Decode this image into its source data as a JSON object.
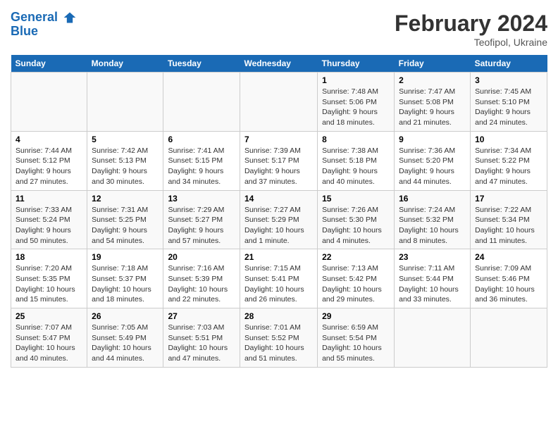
{
  "header": {
    "logo_line1": "General",
    "logo_line2": "Blue",
    "month_year": "February 2024",
    "location": "Teofipol, Ukraine"
  },
  "days_of_week": [
    "Sunday",
    "Monday",
    "Tuesday",
    "Wednesday",
    "Thursday",
    "Friday",
    "Saturday"
  ],
  "weeks": [
    [
      {
        "day": "",
        "info": ""
      },
      {
        "day": "",
        "info": ""
      },
      {
        "day": "",
        "info": ""
      },
      {
        "day": "",
        "info": ""
      },
      {
        "day": "1",
        "info": "Sunrise: 7:48 AM\nSunset: 5:06 PM\nDaylight: 9 hours\nand 18 minutes."
      },
      {
        "day": "2",
        "info": "Sunrise: 7:47 AM\nSunset: 5:08 PM\nDaylight: 9 hours\nand 21 minutes."
      },
      {
        "day": "3",
        "info": "Sunrise: 7:45 AM\nSunset: 5:10 PM\nDaylight: 9 hours\nand 24 minutes."
      }
    ],
    [
      {
        "day": "4",
        "info": "Sunrise: 7:44 AM\nSunset: 5:12 PM\nDaylight: 9 hours\nand 27 minutes."
      },
      {
        "day": "5",
        "info": "Sunrise: 7:42 AM\nSunset: 5:13 PM\nDaylight: 9 hours\nand 30 minutes."
      },
      {
        "day": "6",
        "info": "Sunrise: 7:41 AM\nSunset: 5:15 PM\nDaylight: 9 hours\nand 34 minutes."
      },
      {
        "day": "7",
        "info": "Sunrise: 7:39 AM\nSunset: 5:17 PM\nDaylight: 9 hours\nand 37 minutes."
      },
      {
        "day": "8",
        "info": "Sunrise: 7:38 AM\nSunset: 5:18 PM\nDaylight: 9 hours\nand 40 minutes."
      },
      {
        "day": "9",
        "info": "Sunrise: 7:36 AM\nSunset: 5:20 PM\nDaylight: 9 hours\nand 44 minutes."
      },
      {
        "day": "10",
        "info": "Sunrise: 7:34 AM\nSunset: 5:22 PM\nDaylight: 9 hours\nand 47 minutes."
      }
    ],
    [
      {
        "day": "11",
        "info": "Sunrise: 7:33 AM\nSunset: 5:24 PM\nDaylight: 9 hours\nand 50 minutes."
      },
      {
        "day": "12",
        "info": "Sunrise: 7:31 AM\nSunset: 5:25 PM\nDaylight: 9 hours\nand 54 minutes."
      },
      {
        "day": "13",
        "info": "Sunrise: 7:29 AM\nSunset: 5:27 PM\nDaylight: 9 hours\nand 57 minutes."
      },
      {
        "day": "14",
        "info": "Sunrise: 7:27 AM\nSunset: 5:29 PM\nDaylight: 10 hours\nand 1 minute."
      },
      {
        "day": "15",
        "info": "Sunrise: 7:26 AM\nSunset: 5:30 PM\nDaylight: 10 hours\nand 4 minutes."
      },
      {
        "day": "16",
        "info": "Sunrise: 7:24 AM\nSunset: 5:32 PM\nDaylight: 10 hours\nand 8 minutes."
      },
      {
        "day": "17",
        "info": "Sunrise: 7:22 AM\nSunset: 5:34 PM\nDaylight: 10 hours\nand 11 minutes."
      }
    ],
    [
      {
        "day": "18",
        "info": "Sunrise: 7:20 AM\nSunset: 5:35 PM\nDaylight: 10 hours\nand 15 minutes."
      },
      {
        "day": "19",
        "info": "Sunrise: 7:18 AM\nSunset: 5:37 PM\nDaylight: 10 hours\nand 18 minutes."
      },
      {
        "day": "20",
        "info": "Sunrise: 7:16 AM\nSunset: 5:39 PM\nDaylight: 10 hours\nand 22 minutes."
      },
      {
        "day": "21",
        "info": "Sunrise: 7:15 AM\nSunset: 5:41 PM\nDaylight: 10 hours\nand 26 minutes."
      },
      {
        "day": "22",
        "info": "Sunrise: 7:13 AM\nSunset: 5:42 PM\nDaylight: 10 hours\nand 29 minutes."
      },
      {
        "day": "23",
        "info": "Sunrise: 7:11 AM\nSunset: 5:44 PM\nDaylight: 10 hours\nand 33 minutes."
      },
      {
        "day": "24",
        "info": "Sunrise: 7:09 AM\nSunset: 5:46 PM\nDaylight: 10 hours\nand 36 minutes."
      }
    ],
    [
      {
        "day": "25",
        "info": "Sunrise: 7:07 AM\nSunset: 5:47 PM\nDaylight: 10 hours\nand 40 minutes."
      },
      {
        "day": "26",
        "info": "Sunrise: 7:05 AM\nSunset: 5:49 PM\nDaylight: 10 hours\nand 44 minutes."
      },
      {
        "day": "27",
        "info": "Sunrise: 7:03 AM\nSunset: 5:51 PM\nDaylight: 10 hours\nand 47 minutes."
      },
      {
        "day": "28",
        "info": "Sunrise: 7:01 AM\nSunset: 5:52 PM\nDaylight: 10 hours\nand 51 minutes."
      },
      {
        "day": "29",
        "info": "Sunrise: 6:59 AM\nSunset: 5:54 PM\nDaylight: 10 hours\nand 55 minutes."
      },
      {
        "day": "",
        "info": ""
      },
      {
        "day": "",
        "info": ""
      }
    ]
  ]
}
